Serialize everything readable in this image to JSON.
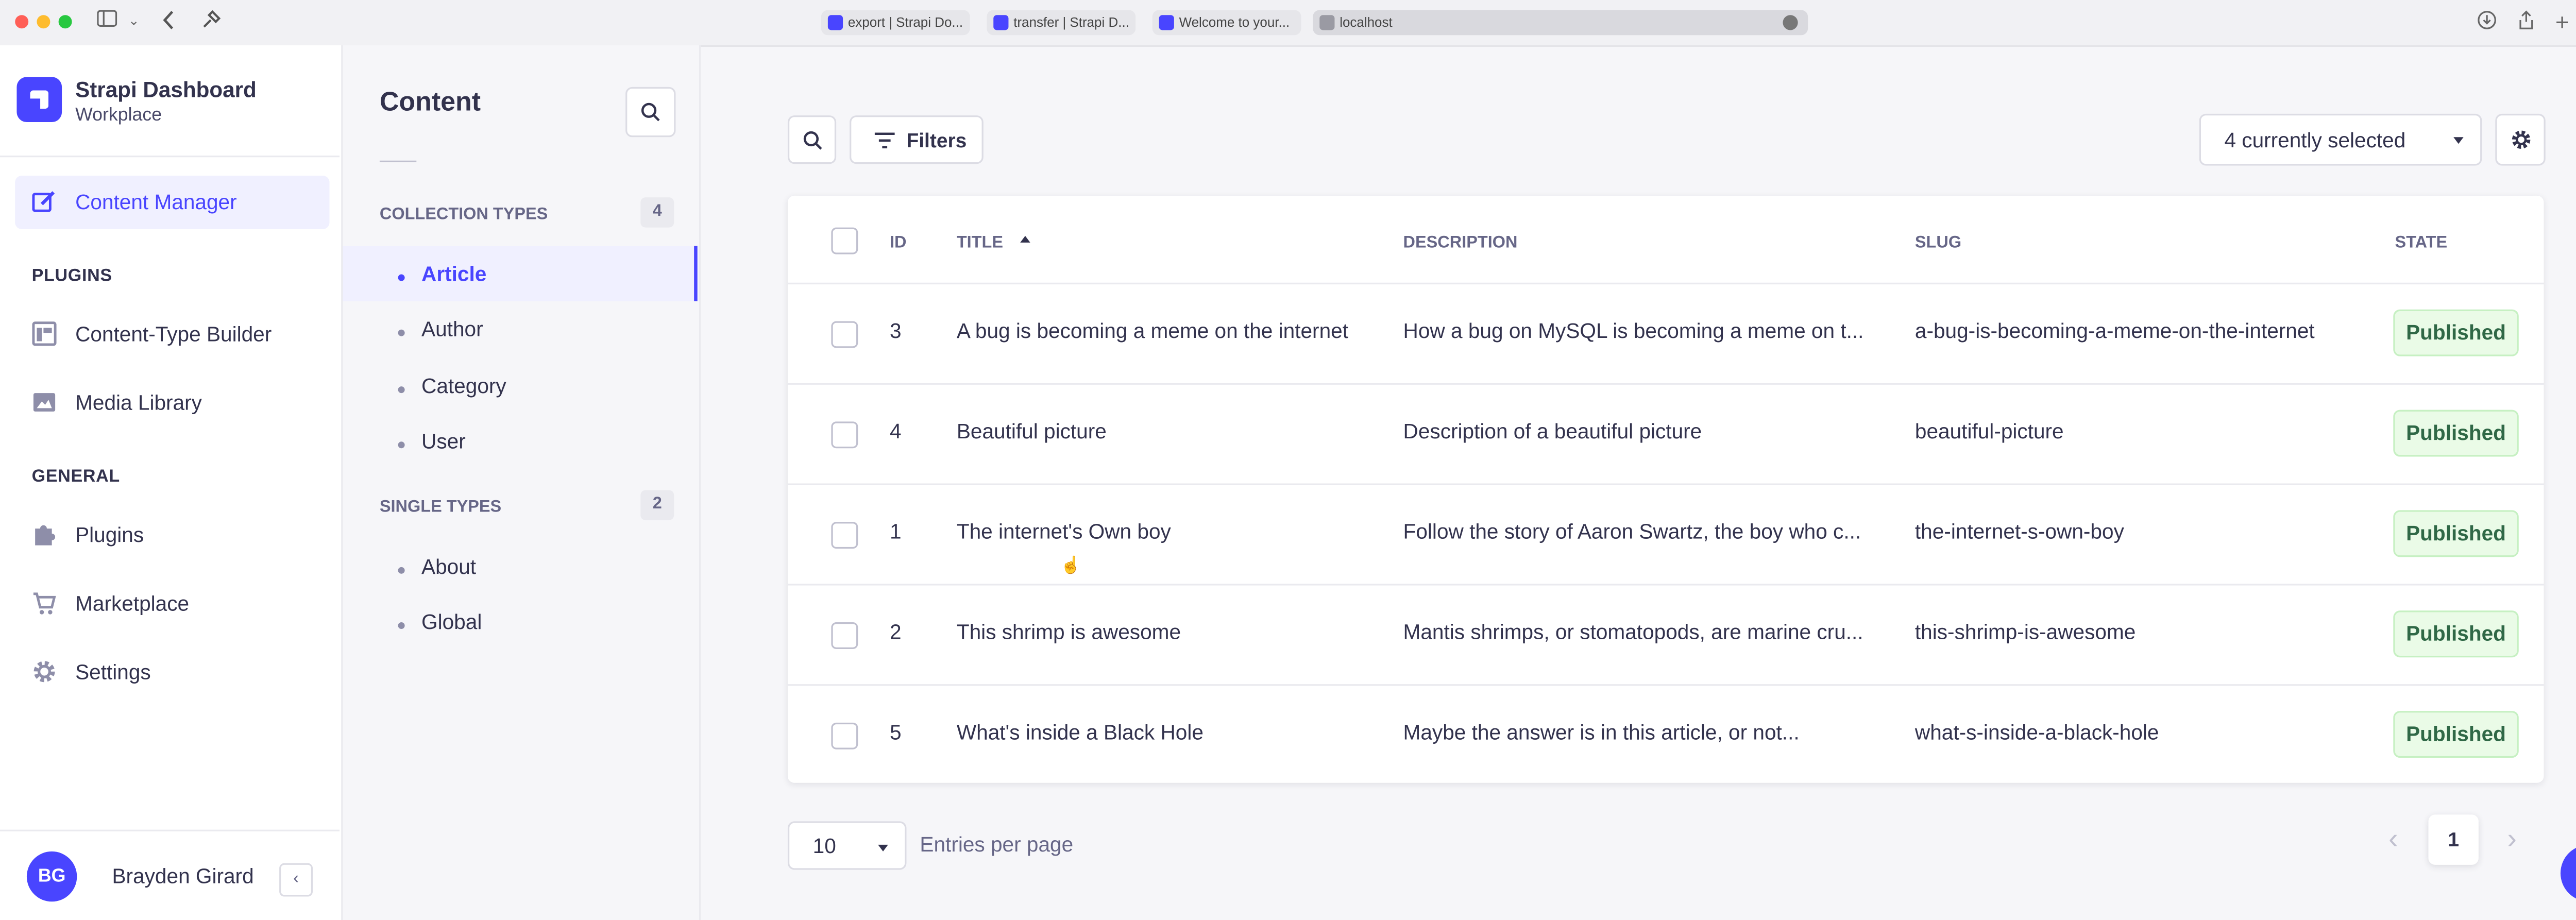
{
  "browser": {
    "tabs": [
      {
        "label": "export | Strapi Do..."
      },
      {
        "label": "transfer | Strapi D..."
      },
      {
        "label": "Welcome to your..."
      },
      {
        "label": "localhost"
      }
    ]
  },
  "mainnav": {
    "brand_title": "Strapi Dashboard",
    "brand_subtitle": "Workplace",
    "content_manager": "Content Manager",
    "plugins_heading": "PLUGINS",
    "content_type_builder": "Content-Type Builder",
    "media_library": "Media Library",
    "general_heading": "GENERAL",
    "plugins": "Plugins",
    "marketplace": "Marketplace",
    "settings": "Settings",
    "user_initials": "BG",
    "user_name": "Brayden Girard"
  },
  "subnav": {
    "title": "Content",
    "collection_types_label": "COLLECTION TYPES",
    "collection_types_count": "4",
    "collection_types": [
      "Article",
      "Author",
      "Category",
      "User"
    ],
    "single_types_label": "SINGLE TYPES",
    "single_types_count": "2",
    "single_types": [
      "About",
      "Global"
    ]
  },
  "toolbar": {
    "filters_label": "Filters",
    "columns_select": "4 currently selected"
  },
  "table": {
    "headers": {
      "id": "ID",
      "title": "TITLE",
      "description": "DESCRIPTION",
      "slug": "SLUG",
      "state": "STATE"
    },
    "rows": [
      {
        "id": "3",
        "title": "A bug is becoming a meme on the internet",
        "description": "How a bug on MySQL is becoming a meme on t...",
        "slug": "a-bug-is-becoming-a-meme-on-the-internet",
        "state": "Published"
      },
      {
        "id": "4",
        "title": "Beautiful picture",
        "description": "Description of a beautiful picture",
        "slug": "beautiful-picture",
        "state": "Published"
      },
      {
        "id": "1",
        "title": "The internet's Own boy",
        "description": "Follow the story of Aaron Swartz, the boy who c...",
        "slug": "the-internet-s-own-boy",
        "state": "Published"
      },
      {
        "id": "2",
        "title": "This shrimp is awesome",
        "description": "Mantis shrimps, or stomatopods, are marine cru...",
        "slug": "this-shrimp-is-awesome",
        "state": "Published"
      },
      {
        "id": "5",
        "title": "What's inside a Black Hole",
        "description": "Maybe the answer is in this article, or not...",
        "slug": "what-s-inside-a-black-hole",
        "state": "Published"
      }
    ]
  },
  "pagination": {
    "per_page": "10",
    "per_page_label": "Entries per page",
    "current_page": "1"
  },
  "help_label": "?",
  "colors": {
    "accent": "#4945ff",
    "published_bg": "#eafbe7",
    "published_text": "#2f6846"
  }
}
